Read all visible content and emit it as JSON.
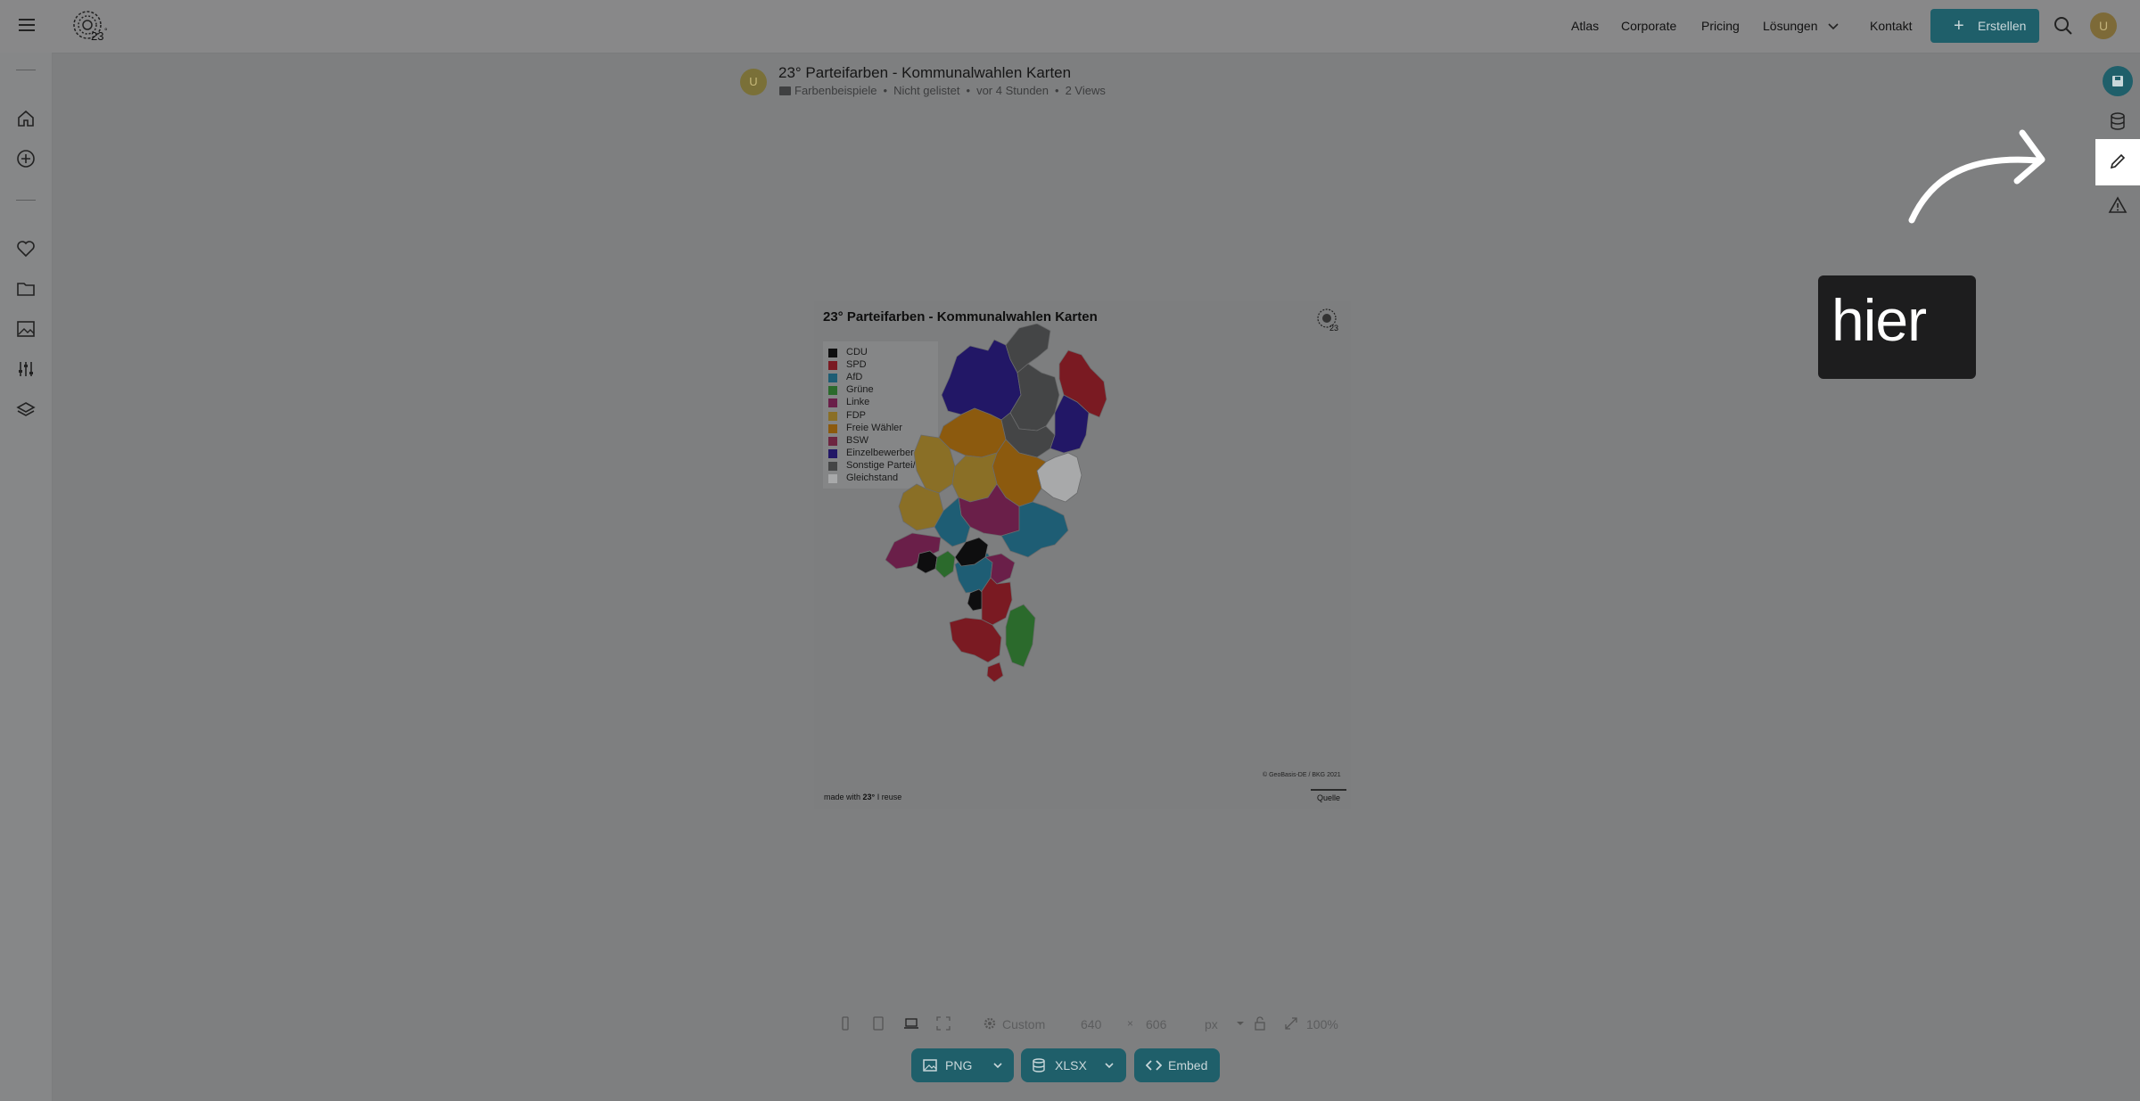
{
  "nav": {
    "links": [
      "Atlas",
      "Corporate",
      "Pricing",
      "Lösungen",
      "Kontakt"
    ],
    "create_label": "Erstellen",
    "user_initial": "U"
  },
  "doc": {
    "avatar_initial": "U",
    "title": "23° Parteifarben - Kommunalwahlen Karten",
    "folder": "Farbenbeispiele",
    "visibility": "Nicht gelistet",
    "time": "vor 4 Stunden",
    "views": "2 Views"
  },
  "card": {
    "title": "23° Parteifarben - Kommunalwahlen Karten",
    "legend": [
      {
        "label": "CDU",
        "color": "#0e0e0f"
      },
      {
        "label": "SPD",
        "color": "#7a1a22"
      },
      {
        "label": "AfD",
        "color": "#1e5d74"
      },
      {
        "label": "Grüne",
        "color": "#2b6a2c"
      },
      {
        "label": "Linke",
        "color": "#6a1f49"
      },
      {
        "label": "FDP",
        "color": "#8a6f26"
      },
      {
        "label": "Freie Wähler",
        "color": "#8c5a0e"
      },
      {
        "label": "BSW",
        "color": "#6d2540"
      },
      {
        "label": "Einzelbewerber",
        "color": "#221766"
      },
      {
        "label": "Sonstige Partei/WG",
        "color": "#444546"
      },
      {
        "label": "Gleichstand",
        "color": "#a8a9aa"
      }
    ],
    "copyright": "© GeoBasis-DE / BKG 2021",
    "footer_made": "made with",
    "footer_brand": "23°",
    "footer_reuse": "I reuse",
    "source": "Quelle"
  },
  "toolbar": {
    "preset": "Custom",
    "width": "640",
    "times": "×",
    "height": "606",
    "unit": "px",
    "zoom": "100%"
  },
  "exports": {
    "png": "PNG",
    "xlsx": "XLSX",
    "embed": "Embed"
  },
  "annotation": {
    "text": "hier"
  }
}
